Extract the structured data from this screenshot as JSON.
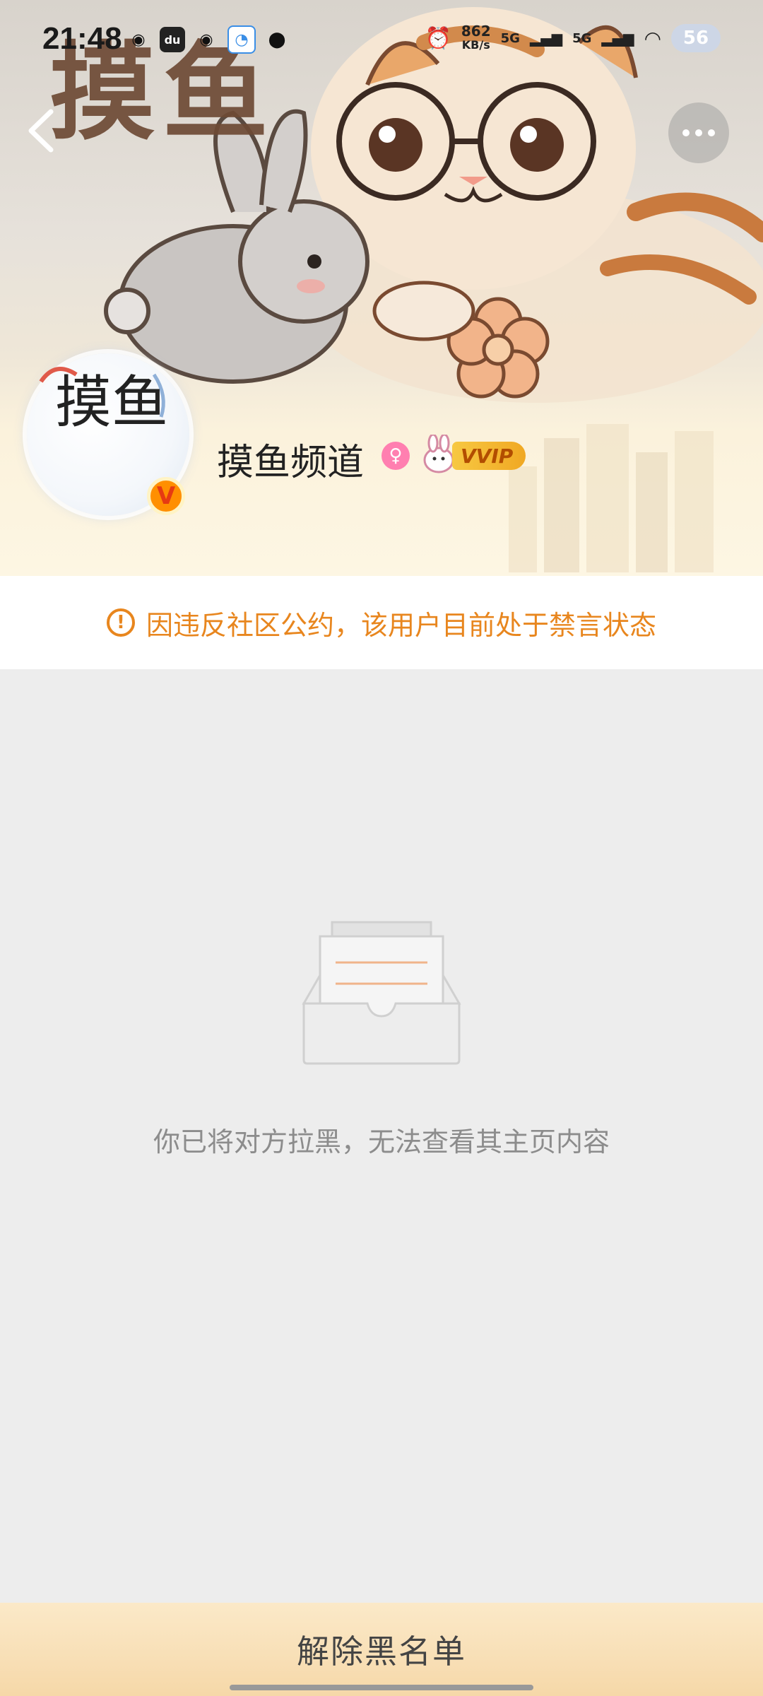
{
  "status_bar": {
    "time": "21:48",
    "net_speed_value": "862",
    "net_speed_unit": "KB/s",
    "signal_1": "5G",
    "signal_2": "5G",
    "battery": "56"
  },
  "banner": {
    "title": "摸鱼"
  },
  "profile": {
    "avatar_text": "摸鱼",
    "verified_badge": "V",
    "username": "摸鱼频道",
    "vip_label": "VVIP"
  },
  "warning": {
    "icon": "!",
    "text": "因违反社区公约，该用户目前处于禁言状态"
  },
  "empty_state": {
    "text": "你已将对方拉黑，无法查看其主页内容"
  },
  "bottom": {
    "unblock_label": "解除黑名单"
  },
  "colors": {
    "warning": "#e8861e",
    "background": "#ededed",
    "vip_gold": "#f0a823"
  }
}
